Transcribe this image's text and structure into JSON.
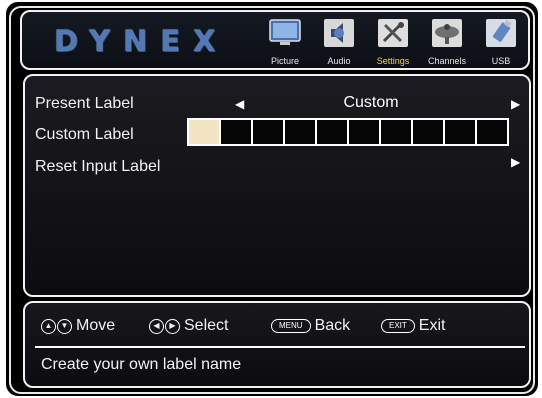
{
  "brand": {
    "logo": "DYNEX"
  },
  "menu_tabs": [
    {
      "label": "Picture",
      "icon": "tv-icon",
      "active": false
    },
    {
      "label": "Audio",
      "icon": "speaker-icon",
      "active": false
    },
    {
      "label": "Settings",
      "icon": "tools-icon",
      "active": true
    },
    {
      "label": "Channels",
      "icon": "satellite-dish-icon",
      "active": false
    },
    {
      "label": "USB",
      "icon": "usb-drive-icon",
      "active": false
    }
  ],
  "settings": {
    "present_label": {
      "label": "Present Label",
      "value": "Custom"
    },
    "custom_label": {
      "label": "Custom Label",
      "cell_count": 10,
      "active_cell": 0
    },
    "reset_input_label": {
      "label": "Reset Input Label"
    }
  },
  "hints": {
    "move": "Move",
    "select": "Select",
    "back": "Back",
    "back_key": "MENU",
    "exit": "Exit",
    "exit_key": "EXIT"
  },
  "help_text": "Create your own label name",
  "colors": {
    "logo": "#4f79b8",
    "active_tab_label": "#f2d33a",
    "active_cell": "#f3e4c3"
  }
}
